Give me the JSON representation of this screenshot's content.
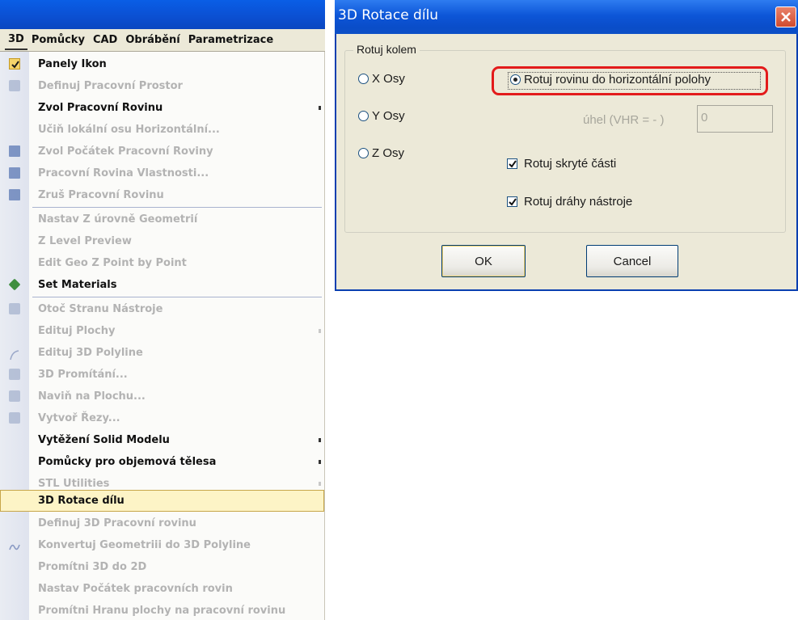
{
  "menubar": {
    "items": [
      "3D",
      "Pomůcky",
      "CAD",
      "Obrábění",
      "Parametrizace"
    ]
  },
  "menu": {
    "items": [
      {
        "label": "Panely Ikon",
        "enabled": true
      },
      {
        "label": "Definuj Pracovní Prostor",
        "enabled": false
      },
      {
        "label": "Zvol Pracovní Rovinu",
        "enabled": true
      },
      {
        "label": "Učiň lokální osu Horizontální...",
        "enabled": false
      },
      {
        "label": "Zvol Počátek Pracovní Roviny",
        "enabled": false
      },
      {
        "label": "Pracovní Rovina Vlastnosti...",
        "enabled": false
      },
      {
        "label": "Zruš Pracovní Rovinu",
        "enabled": false
      },
      {
        "label": "Nastav Z úrovně Geometrií",
        "enabled": false
      },
      {
        "label": "Z Level Preview",
        "enabled": false
      },
      {
        "label": "Edit Geo Z Point by Point",
        "enabled": false
      },
      {
        "label": "Set Materials",
        "enabled": true
      },
      {
        "label": "Otoč Stranu Nástroje",
        "enabled": false
      },
      {
        "label": "Edituj Plochy",
        "enabled": false
      },
      {
        "label": "Edituj 3D Polyline",
        "enabled": false
      },
      {
        "label": "3D Promítání...",
        "enabled": false
      },
      {
        "label": "Naviň na Plochu...",
        "enabled": false
      },
      {
        "label": "Vytvoř Řezy...",
        "enabled": false
      },
      {
        "label": "Vytěžení Solid Modelu",
        "enabled": true
      },
      {
        "label": "Pomůcky pro objemová tělesa",
        "enabled": true
      },
      {
        "label": "STL Utilities",
        "enabled": false
      },
      {
        "label": "3D Rotace dílu",
        "enabled": true
      },
      {
        "label": "Definuj 3D Pracovní rovinu",
        "enabled": false
      },
      {
        "label": "Konvertuj Geometriii do 3D Polyline",
        "enabled": false
      },
      {
        "label": "Promítni 3D do 2D",
        "enabled": false
      },
      {
        "label": "Nastav Počátek pracovních rovin",
        "enabled": false
      },
      {
        "label": "Promítni Hranu plochy na pracovní rovinu",
        "enabled": false
      }
    ]
  },
  "dialog": {
    "title": "3D Rotace dílu",
    "group_label": "Rotuj kolem",
    "axis_options": [
      "X Osy",
      "Y Osy",
      "Z Osy"
    ],
    "rotate_horizontal_label": "Rotuj rovinu do horizontální polohy",
    "rotate_horizontal_selected": true,
    "angle_label": "úhel (VHR = - )",
    "angle_value": "0",
    "rotate_hidden_label": "Rotuj skryté části",
    "rotate_hidden_checked": true,
    "rotate_toolpaths_label": "Rotuj dráhy nástroje",
    "rotate_toolpaths_checked": true,
    "ok_label": "OK",
    "cancel_label": "Cancel"
  },
  "colors": {
    "highlight_border": "#e31b1b",
    "titlebar": "#0b4fd1",
    "disabled_text": "#b3b3b3"
  }
}
